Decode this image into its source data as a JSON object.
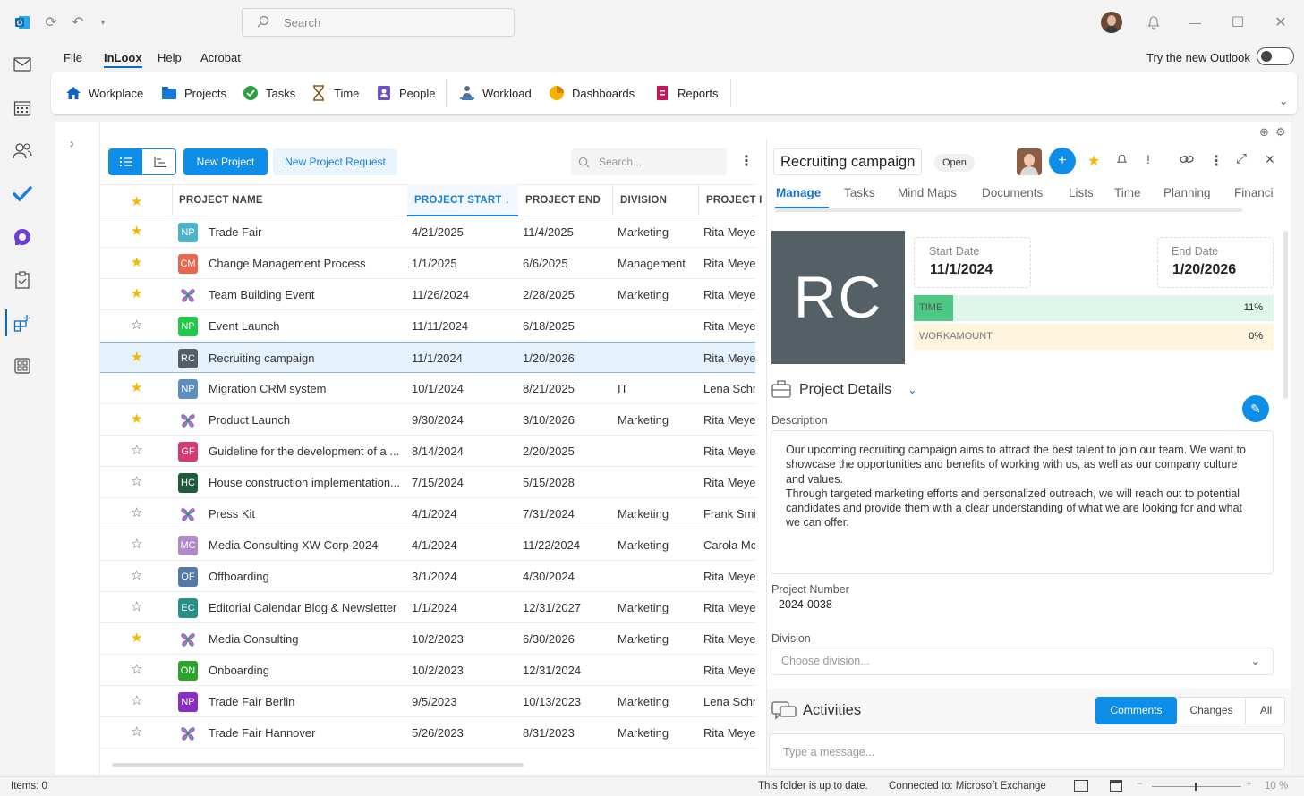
{
  "titlebar": {
    "search_placeholder": "Search"
  },
  "menu": {
    "file": "File",
    "inloox": "InLoox",
    "help": "Help",
    "acrobat": "Acrobat",
    "try_outlook": "Try the new Outlook"
  },
  "ribbon": {
    "workplace": "Workplace",
    "projects": "Projects",
    "tasks": "Tasks",
    "time": "Time",
    "people": "People",
    "workload": "Workload",
    "dashboards": "Dashboards",
    "reports": "Reports"
  },
  "toolbar": {
    "new_project": "New Project",
    "new_project_request": "New Project Request",
    "search_placeholder": "Search..."
  },
  "table": {
    "headers": {
      "name": "PROJECT NAME",
      "start": "PROJECT START ↓",
      "end": "PROJECT END",
      "division": "DIVISION",
      "pm": "PROJECT I"
    },
    "rows": [
      {
        "fav": true,
        "badge": "NP",
        "color": "#4bb3c9",
        "name": "Trade Fair",
        "start": "4/21/2025",
        "end": "11/4/2025",
        "division": "Marketing",
        "pm": "Rita Meyer"
      },
      {
        "fav": true,
        "badge": "CM",
        "color": "#e8674d",
        "name": "Change Management Process",
        "start": "1/1/2025",
        "end": "6/6/2025",
        "division": "Management",
        "pm": "Rita Meyer"
      },
      {
        "fav": true,
        "badge": "",
        "color": "",
        "name": "Team Building Event",
        "start": "11/26/2024",
        "end": "2/28/2025",
        "division": "Marketing",
        "pm": "Rita Meyer"
      },
      {
        "fav": false,
        "badge": "NP",
        "color": "#1fc94a",
        "name": "Event Launch",
        "start": "11/11/2024",
        "end": "6/18/2025",
        "division": "",
        "pm": "Rita Meyer"
      },
      {
        "fav": true,
        "badge": "RC",
        "color": "#555f66",
        "name": "Recruiting campaign",
        "start": "11/1/2024",
        "end": "1/20/2026",
        "division": "",
        "pm": "Rita Meyer"
      },
      {
        "fav": true,
        "badge": "NP",
        "color": "#5c8ec0",
        "name": "Migration CRM system",
        "start": "10/1/2024",
        "end": "8/21/2025",
        "division": "IT",
        "pm": "Lena Schn"
      },
      {
        "fav": true,
        "badge": "",
        "color": "",
        "name": "Product Launch",
        "start": "9/30/2024",
        "end": "3/10/2026",
        "division": "Marketing",
        "pm": "Rita Meyer"
      },
      {
        "fav": false,
        "badge": "GF",
        "color": "#d63a73",
        "name": "Guideline for the development of a ...",
        "start": "8/14/2024",
        "end": "2/20/2025",
        "division": "",
        "pm": "Rita Meyer"
      },
      {
        "fav": false,
        "badge": "HC",
        "color": "#1d5c3b",
        "name": "House construction implementation...",
        "start": "7/15/2024",
        "end": "5/15/2028",
        "division": "",
        "pm": "Rita Meyer"
      },
      {
        "fav": false,
        "badge": "",
        "color": "",
        "name": "Press Kit",
        "start": "4/1/2024",
        "end": "7/31/2024",
        "division": "Marketing",
        "pm": "Frank Smit"
      },
      {
        "fav": false,
        "badge": "MC",
        "color": "#b08ac6",
        "name": "Media Consulting XW Corp 2024",
        "start": "4/1/2024",
        "end": "11/22/2024",
        "division": "Marketing",
        "pm": "Carola Mc"
      },
      {
        "fav": false,
        "badge": "OF",
        "color": "#5479a8",
        "name": "Offboarding",
        "start": "3/1/2024",
        "end": "4/30/2024",
        "division": "",
        "pm": "Rita Meyer"
      },
      {
        "fav": false,
        "badge": "EC",
        "color": "#24928b",
        "name": "Editorial Calendar Blog & Newsletter",
        "start": "1/1/2024",
        "end": "12/31/2027",
        "division": "Marketing",
        "pm": "Rita Meyer"
      },
      {
        "fav": true,
        "badge": "",
        "color": "",
        "name": "Media Consulting",
        "start": "10/2/2023",
        "end": "6/30/2026",
        "division": "Marketing",
        "pm": "Rita Meyer"
      },
      {
        "fav": false,
        "badge": "ON",
        "color": "#2aa52a",
        "name": "Onboarding",
        "start": "10/2/2023",
        "end": "12/31/2024",
        "division": "",
        "pm": "Rita Meyer"
      },
      {
        "fav": false,
        "badge": "NP",
        "color": "#8b2cc4",
        "name": "Trade Fair Berlin",
        "start": "9/5/2023",
        "end": "10/13/2023",
        "division": "Marketing",
        "pm": "Lena Schn"
      },
      {
        "fav": false,
        "badge": "",
        "color": "",
        "name": "Trade Fair Hannover",
        "start": "5/26/2023",
        "end": "8/31/2023",
        "division": "Marketing",
        "pm": "Rita Meyer"
      }
    ]
  },
  "detail": {
    "title": "Recruiting campaign",
    "status": "Open",
    "tabs": [
      "Manage",
      "Tasks",
      "Mind Maps",
      "Documents",
      "Lists",
      "Time",
      "Planning",
      "Financi"
    ],
    "initials": "RC",
    "start_label": "Start Date",
    "start_value": "11/1/2024",
    "end_label": "End Date",
    "end_value": "1/20/2026",
    "time_label": "TIME",
    "time_value": "11%",
    "time_fraction": 0.11,
    "work_label": "WORKAMOUNT",
    "work_value": "0%",
    "section_title": "Project Details",
    "desc_label": "Description",
    "desc_p1": "Our upcoming recruiting campaign aims to attract the best talent to join our team. We want to showcase the opportunities and benefits of working with us, as well as our company culture and values.",
    "desc_p2": "Through targeted marketing efforts and personalized outreach, we will reach out to potential candidates and provide them with a clear understanding of what we are looking for and what we can offer.",
    "number_label": "Project Number",
    "number_value": "2024-0038",
    "division_label": "Division",
    "division_placeholder": "Choose division...",
    "activities_title": "Activities",
    "act_tabs": [
      "Comments",
      "Changes",
      "All"
    ],
    "message_placeholder": "Type a message..."
  },
  "statusbar": {
    "items": "Items: 0",
    "uptodate": "This folder is up to date.",
    "connected": "Connected to: Microsoft Exchange",
    "zoom": "10 %"
  }
}
